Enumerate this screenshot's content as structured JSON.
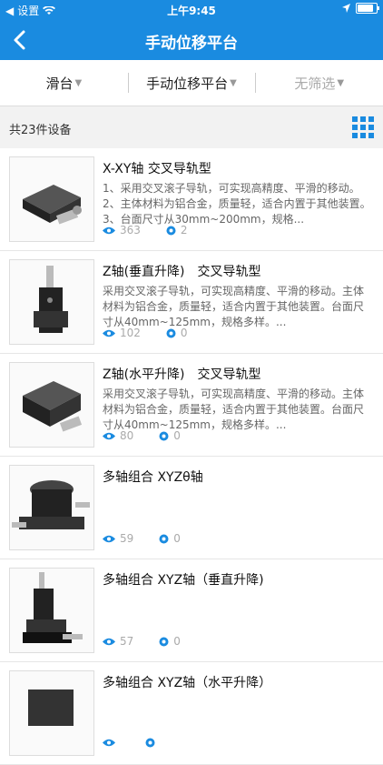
{
  "status_bar": {
    "carrier": "设置",
    "time": "上午9:45",
    "battery_level": 0.92
  },
  "nav": {
    "title": "手动位移平台"
  },
  "filters": [
    {
      "label": "滑台"
    },
    {
      "label": "手动位移平台"
    },
    {
      "label": "无筛选"
    }
  ],
  "count_text": "共23件设备",
  "colors": {
    "accent": "#1a8be0"
  },
  "items": [
    {
      "name": "X-XY轴 交叉导轨型",
      "desc": "1、采用交叉滚子导轨，可实现高精度、平滑的移动。2、主体材料为铝合金，质量轻，适合内置于其他装置。3、台面尺寸从30mm~200mm，规格...",
      "views": "363",
      "comments": "2"
    },
    {
      "name": "Z轴(垂直升降)　交叉导轨型",
      "desc": "采用交叉滚子导轨，可实现高精度、平滑的移动。主体材料为铝合金，质量轻，适合内置于其他装置。台面尺寸从40mm~125mm，规格多样。...",
      "views": "102",
      "comments": "0"
    },
    {
      "name": "Z轴(水平升降)　交叉导轨型",
      "desc": "采用交叉滚子导轨，可实现高精度、平滑的移动。主体材料为铝合金，质量轻，适合内置于其他装置。台面尺寸从40mm~125mm，规格多样。...",
      "views": "80",
      "comments": "0"
    },
    {
      "name": "多轴组合 XYZθ轴",
      "desc": "",
      "views": "59",
      "comments": "0"
    },
    {
      "name": "多轴组合 XYZ轴（垂直升降)",
      "desc": "",
      "views": "57",
      "comments": "0"
    },
    {
      "name": "多轴组合 XYZ轴（水平升降）",
      "desc": "",
      "views": "",
      "comments": ""
    }
  ]
}
